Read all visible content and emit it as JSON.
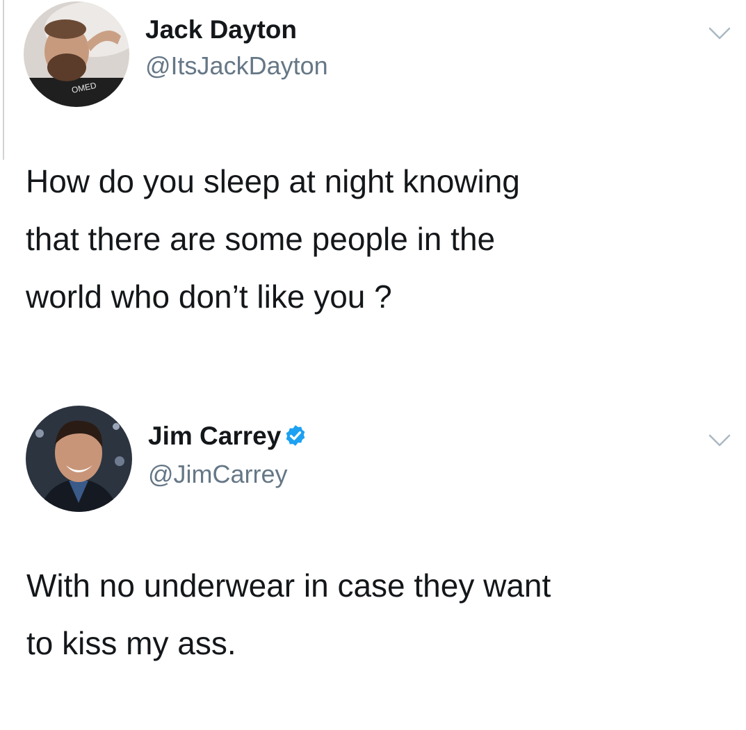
{
  "tweets": [
    {
      "author": {
        "name": "Jack Dayton",
        "handle": "@ItsJackDayton",
        "verified": false,
        "avatar_shirt_text": "OMED"
      },
      "text_lines": [
        "How do you sleep at night knowing",
        "that there are some people in the",
        "world who don’t like you ?"
      ],
      "menu_icon": "chevron-down-icon"
    },
    {
      "author": {
        "name": "Jim Carrey",
        "handle": "@JimCarrey",
        "verified": true
      },
      "text_lines": [
        "With no underwear in case they want",
        "to kiss my ass."
      ],
      "menu_icon": "chevron-down-icon"
    }
  ],
  "colors": {
    "text_primary": "#14171a",
    "text_secondary": "#657786",
    "verified_blue": "#1da1f2",
    "chevron_gray": "#aab8c2"
  }
}
